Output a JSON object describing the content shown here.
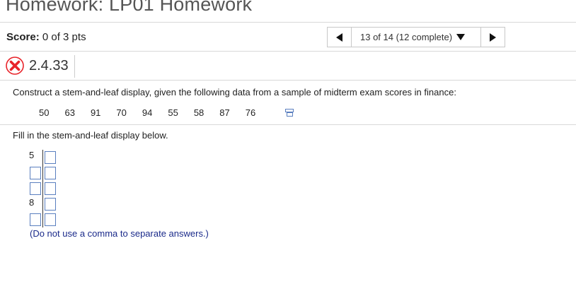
{
  "page": {
    "title": "Homework: LP01 Homework"
  },
  "header": {
    "score_label": "Score:",
    "score_value": "0 of 3 pts",
    "nav_select": "13 of 14 (12 complete)"
  },
  "question": {
    "number": "2.4.33",
    "prompt": "Construct a stem-and-leaf display, given the following data from a sample of midterm exam scores in finance:",
    "data": [
      "50",
      "63",
      "91",
      "70",
      "94",
      "55",
      "58",
      "87",
      "76"
    ],
    "instruction": "Fill in the stem-and-leaf display below.",
    "stems": [
      "5",
      "",
      "",
      "8",
      ""
    ],
    "note": "(Do not use a comma to separate answers.)"
  },
  "colors": {
    "error_red": "#e8232a",
    "input_border": "#5a7fbf",
    "note_blue": "#1a2a8a"
  }
}
